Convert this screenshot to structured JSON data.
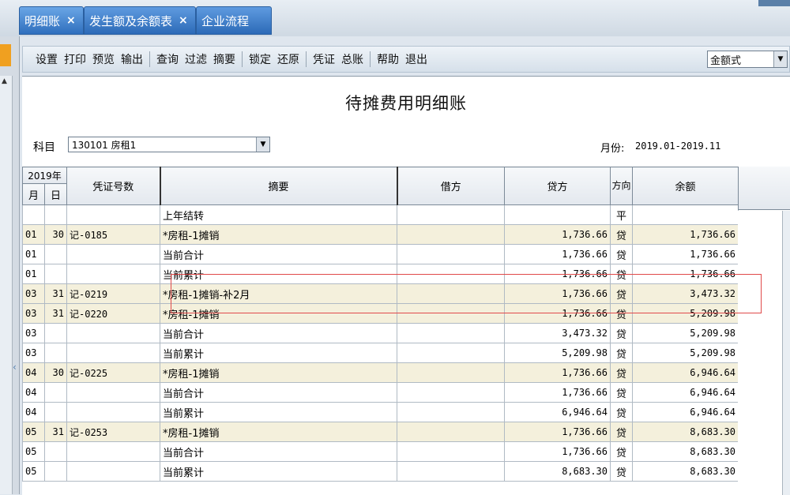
{
  "tabs": [
    {
      "label": "明细账",
      "close": "×"
    },
    {
      "label": "发生额及余额表",
      "close": "×"
    },
    {
      "label": "企业流程"
    }
  ],
  "toolbar": {
    "items": [
      "设置",
      "打印",
      "预览",
      "输出",
      "查询",
      "过滤",
      "摘要",
      "锁定",
      "还原",
      "凭证",
      "总账",
      "帮助",
      "退出"
    ],
    "format_select": "金额式"
  },
  "report": {
    "title": "待摊费用明细账",
    "subject_label": "科目",
    "subject_value": "130101 房租1",
    "month_label": "月份:",
    "month_value": "2019.01-2019.11"
  },
  "table": {
    "year_header": "2019年",
    "month_header": "月",
    "day_header": "日",
    "voucher_header": "凭证号数",
    "summary_header": "摘要",
    "debit_header": "借方",
    "credit_header": "贷方",
    "direction_header": "方向",
    "balance_header": "余额",
    "rows": [
      {
        "m": "",
        "d": "",
        "v": "",
        "s": "上年结转",
        "debit": "",
        "credit": "",
        "dir": "平",
        "bal": ""
      },
      {
        "m": "01",
        "d": "30",
        "v": "记-0185",
        "s": "*房租-1摊销",
        "debit": "",
        "credit": "1,736.66",
        "dir": "贷",
        "bal": "1,736.66"
      },
      {
        "m": "01",
        "d": "",
        "v": "",
        "s": "当前合计",
        "debit": "",
        "credit": "1,736.66",
        "dir": "贷",
        "bal": "1,736.66"
      },
      {
        "m": "01",
        "d": "",
        "v": "",
        "s": "当前累计",
        "debit": "",
        "credit": "1,736.66",
        "dir": "贷",
        "bal": "1,736.66"
      },
      {
        "m": "03",
        "d": "31",
        "v": "记-0219",
        "s": "*房租-1摊销-补2月",
        "debit": "",
        "credit": "1,736.66",
        "dir": "贷",
        "bal": "3,473.32"
      },
      {
        "m": "03",
        "d": "31",
        "v": "记-0220",
        "s": "*房租-1摊销",
        "debit": "",
        "credit": "1,736.66",
        "dir": "贷",
        "bal": "5,209.98"
      },
      {
        "m": "03",
        "d": "",
        "v": "",
        "s": "当前合计",
        "debit": "",
        "credit": "3,473.32",
        "dir": "贷",
        "bal": "5,209.98"
      },
      {
        "m": "03",
        "d": "",
        "v": "",
        "s": "当前累计",
        "debit": "",
        "credit": "5,209.98",
        "dir": "贷",
        "bal": "5,209.98"
      },
      {
        "m": "04",
        "d": "30",
        "v": "记-0225",
        "s": "*房租-1摊销",
        "debit": "",
        "credit": "1,736.66",
        "dir": "贷",
        "bal": "6,946.64"
      },
      {
        "m": "04",
        "d": "",
        "v": "",
        "s": "当前合计",
        "debit": "",
        "credit": "1,736.66",
        "dir": "贷",
        "bal": "6,946.64"
      },
      {
        "m": "04",
        "d": "",
        "v": "",
        "s": "当前累计",
        "debit": "",
        "credit": "6,946.64",
        "dir": "贷",
        "bal": "6,946.64"
      },
      {
        "m": "05",
        "d": "31",
        "v": "记-0253",
        "s": "*房租-1摊销",
        "debit": "",
        "credit": "1,736.66",
        "dir": "贷",
        "bal": "8,683.30"
      },
      {
        "m": "05",
        "d": "",
        "v": "",
        "s": "当前合计",
        "debit": "",
        "credit": "1,736.66",
        "dir": "贷",
        "bal": "8,683.30"
      },
      {
        "m": "05",
        "d": "",
        "v": "",
        "s": "当前累计",
        "debit": "",
        "credit": "8,683.30",
        "dir": "贷",
        "bal": "8,683.30"
      }
    ]
  }
}
